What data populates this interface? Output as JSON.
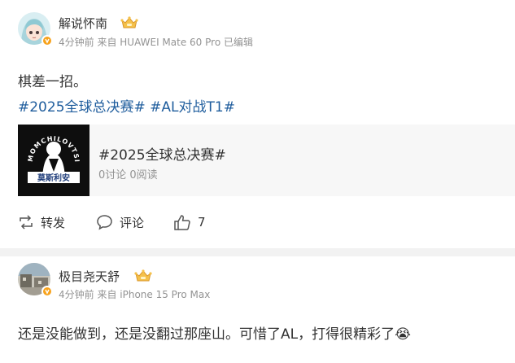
{
  "post1": {
    "username": "解说怀南",
    "meta": "4分钟前 来自 HUAWEI Mate 60 Pro 已编辑",
    "content": "棋差一招。",
    "hashtags": "#2025全球总决赛# #AL对战T1#",
    "topic_card": {
      "title": "#2025全球总决赛#",
      "subtitle": "0讨论 0阅读",
      "thumb_text": "MOMCHILOVTSI",
      "thumb_sign": "莫斯利安"
    },
    "actions": {
      "repost_label": "转发",
      "comment_label": "评论",
      "like_count": "7"
    }
  },
  "post2": {
    "username": "极目尧天舒",
    "meta": "4分钟前 来自 iPhone 15 Pro Max",
    "content": "还是没能做到，还是没翻过那座山。可惜了AL，打得很精彩了😭"
  },
  "colors": {
    "hashtag": "#1f5d9d",
    "verified_badge": "#f7a21b",
    "meta_text": "#939393"
  },
  "icons": [
    "verified-badge-icon",
    "crown-badge-icon",
    "repost-icon",
    "comment-icon",
    "like-icon"
  ]
}
